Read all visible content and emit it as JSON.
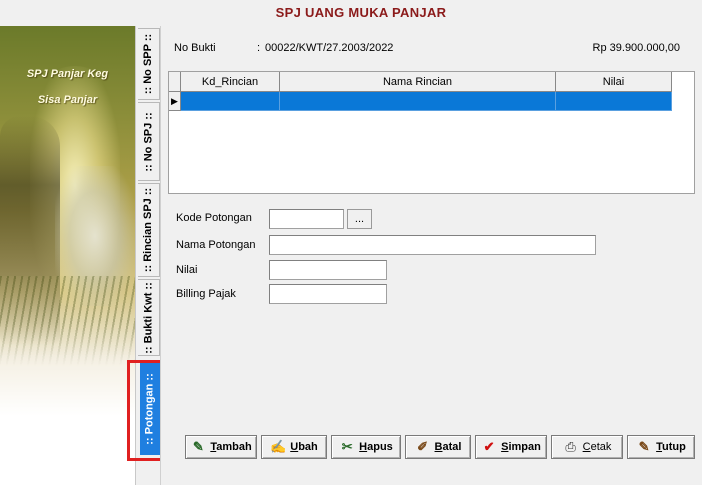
{
  "window": {
    "title": "SPJ UANG MUKA PANJAR"
  },
  "side_panel": {
    "caption_1": "SPJ Panjar Keg",
    "caption_2": "Sisa Panjar"
  },
  "tabs": [
    {
      "label": ":: No SPP ::",
      "active": false
    },
    {
      "label": ":: No SPJ ::",
      "active": false
    },
    {
      "label": ":: Rincian SPJ ::",
      "active": false
    },
    {
      "label": ":: Bukti Kwt ::",
      "active": false
    },
    {
      "label": ":: Potongan ::",
      "active": true
    }
  ],
  "header": {
    "no_bukti_label": "No Bukti",
    "no_bukti_sep": ":",
    "no_bukti_value": "00022/KWT/27.2003/2022",
    "total_amount": "Rp 39.900.000,00"
  },
  "grid": {
    "columns": [
      "Kd_Rincian",
      "Nama Rincian",
      "Nilai"
    ],
    "row_indicator": "▶"
  },
  "form": {
    "kode_potongan_label": "Kode Potongan",
    "kode_potongan_value": "",
    "browse_label": "...",
    "nama_potongan_label": "Nama Potongan",
    "nama_potongan_value": "",
    "nilai_label": "Nilai",
    "nilai_value": "",
    "billing_label": "Billing Pajak",
    "billing_value": ""
  },
  "buttons": [
    {
      "key": "tambah",
      "first": "T",
      "rest": "ambah",
      "icon": "✎"
    },
    {
      "key": "ubah",
      "first": "U",
      "rest": "bah",
      "icon": "✍"
    },
    {
      "key": "hapus",
      "first": "H",
      "rest": "apus",
      "icon": "✂"
    },
    {
      "key": "batal",
      "first": "B",
      "rest": "atal",
      "icon": "✐"
    },
    {
      "key": "simpan",
      "first": "S",
      "rest": "impan",
      "icon": "✔"
    },
    {
      "key": "cetak",
      "first": "C",
      "rest": "etak",
      "icon": "⎙"
    },
    {
      "key": "tutup",
      "first": "T",
      "rest": "utup",
      "icon": "✎"
    }
  ],
  "colors": {
    "title": "#8b1a1a",
    "active_tab": "#1f7fe0",
    "selected_row": "#0a78d7",
    "highlight_box": "#e02020",
    "check_icon": "#d01010"
  }
}
